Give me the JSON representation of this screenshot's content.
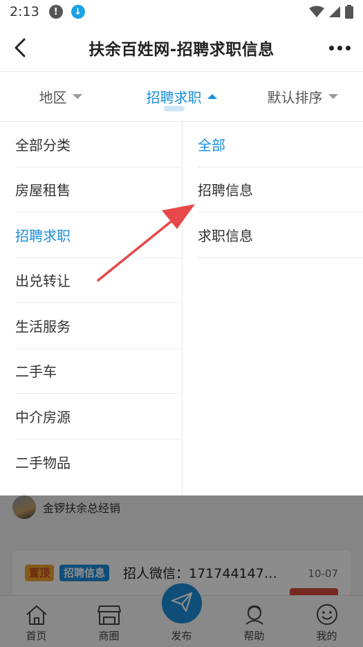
{
  "status_bar": {
    "time": "2:13",
    "alert_glyph": "!",
    "download_glyph": "↓"
  },
  "header": {
    "title": "扶余百姓网-招聘求职信息"
  },
  "filters": [
    {
      "label": "地区",
      "active": false
    },
    {
      "label": "招聘求职",
      "active": true
    },
    {
      "label": "默认排序",
      "active": false
    }
  ],
  "dropdown": {
    "categories": [
      "全部分类",
      "房屋租售",
      "招聘求职",
      "出兑转让",
      "生活服务",
      "二手车",
      "中介房源",
      "二手物品"
    ],
    "selected_category": "招聘求职",
    "subcategories": [
      "全部",
      "招聘信息",
      "求职信息"
    ],
    "selected_subcategory": "全部"
  },
  "feed": {
    "author_name": "金锣扶余总经销",
    "card": {
      "tag_top": "置顶",
      "tag_category": "招聘信息",
      "title": "招人微信：171744147…",
      "date": "10-07"
    }
  },
  "bottom_nav": [
    {
      "label": "首页",
      "icon": "home-icon"
    },
    {
      "label": "商圈",
      "icon": "shop-icon"
    },
    {
      "label": "发布",
      "icon": "send-icon"
    },
    {
      "label": "帮助",
      "icon": "help-icon"
    },
    {
      "label": "我的",
      "icon": "smile-icon"
    }
  ],
  "colors": {
    "accent": "#1a8fdd",
    "annotation_arrow": "#e8484a"
  }
}
